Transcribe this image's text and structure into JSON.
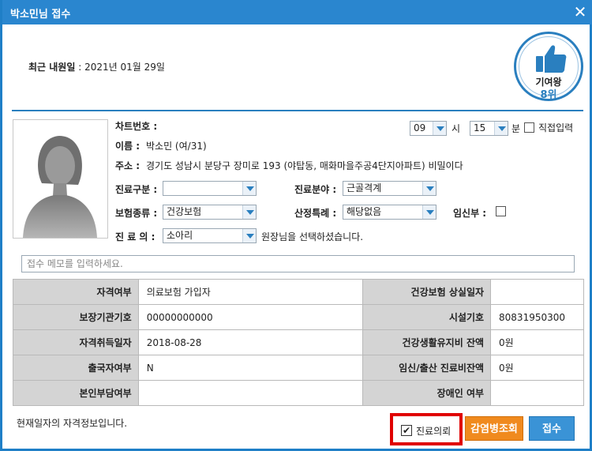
{
  "window": {
    "title": "박소민님 접수",
    "close_icon": "close-icon"
  },
  "last_visit": {
    "label": "최근 내원일",
    "value": " : 2021년 01월 29일"
  },
  "badge": {
    "icon": "thumbs-up-icon",
    "line1": "기여왕",
    "line2": "8위"
  },
  "patient": {
    "chart_label": "차트번호 :",
    "name_label": "이름 :",
    "name_value": "박소민 (여/31)",
    "address_label": "주소 :",
    "address_value": "경기도 성남시 분당구 장미로 193 (야탑동, 매화마을주공4단지아파트) 비밀이다"
  },
  "time": {
    "hour": "09",
    "hour_unit": "시",
    "minute": "15",
    "minute_unit": "분",
    "direct_label": "직접입력"
  },
  "form": {
    "visit_type_label": "진료구분 :",
    "visit_type_value": "",
    "field_label": "진료분야 :",
    "field_value": "근골격계",
    "insurance_label": "보험종류 :",
    "insurance_value": "건강보험",
    "special_label": "산정특례 :",
    "special_value": "해당없음",
    "pregnant_label": "임신부 :",
    "doctor_label": "진 료 의 :",
    "doctor_value": "소아리",
    "doctor_note": "원장님을 선택하셨습니다."
  },
  "memo": {
    "placeholder": "접수 메모를 입력하세요."
  },
  "table": {
    "rows": [
      {
        "k1": "자격여부",
        "v1": "의료보험 가입자",
        "k2": "건강보험 상실일자",
        "v2": ""
      },
      {
        "k1": "보장기관기호",
        "v1": "00000000000",
        "k2": "시설기호",
        "v2": "80831950300"
      },
      {
        "k1": "자격취득일자",
        "v1": "2018-08-28",
        "k2": "건강생활유지비 잔액",
        "v2": "0원"
      },
      {
        "k1": "출국자여부",
        "v1": "N",
        "k2": "임신/출산 진료비잔액",
        "v2": "0원"
      },
      {
        "k1": "본인부담여부",
        "v1": "",
        "k2": "장애인 여부",
        "v2": ""
      }
    ]
  },
  "footer": {
    "note": "현재일자의 자격정보입니다.",
    "refer_check": "✔",
    "refer_label": "진료의뢰",
    "infection_button": "감염병조회",
    "submit_button": "접수"
  },
  "colors": {
    "accent": "#2a86cf",
    "highlight": "#e00000",
    "orange": "#f08a1e"
  }
}
